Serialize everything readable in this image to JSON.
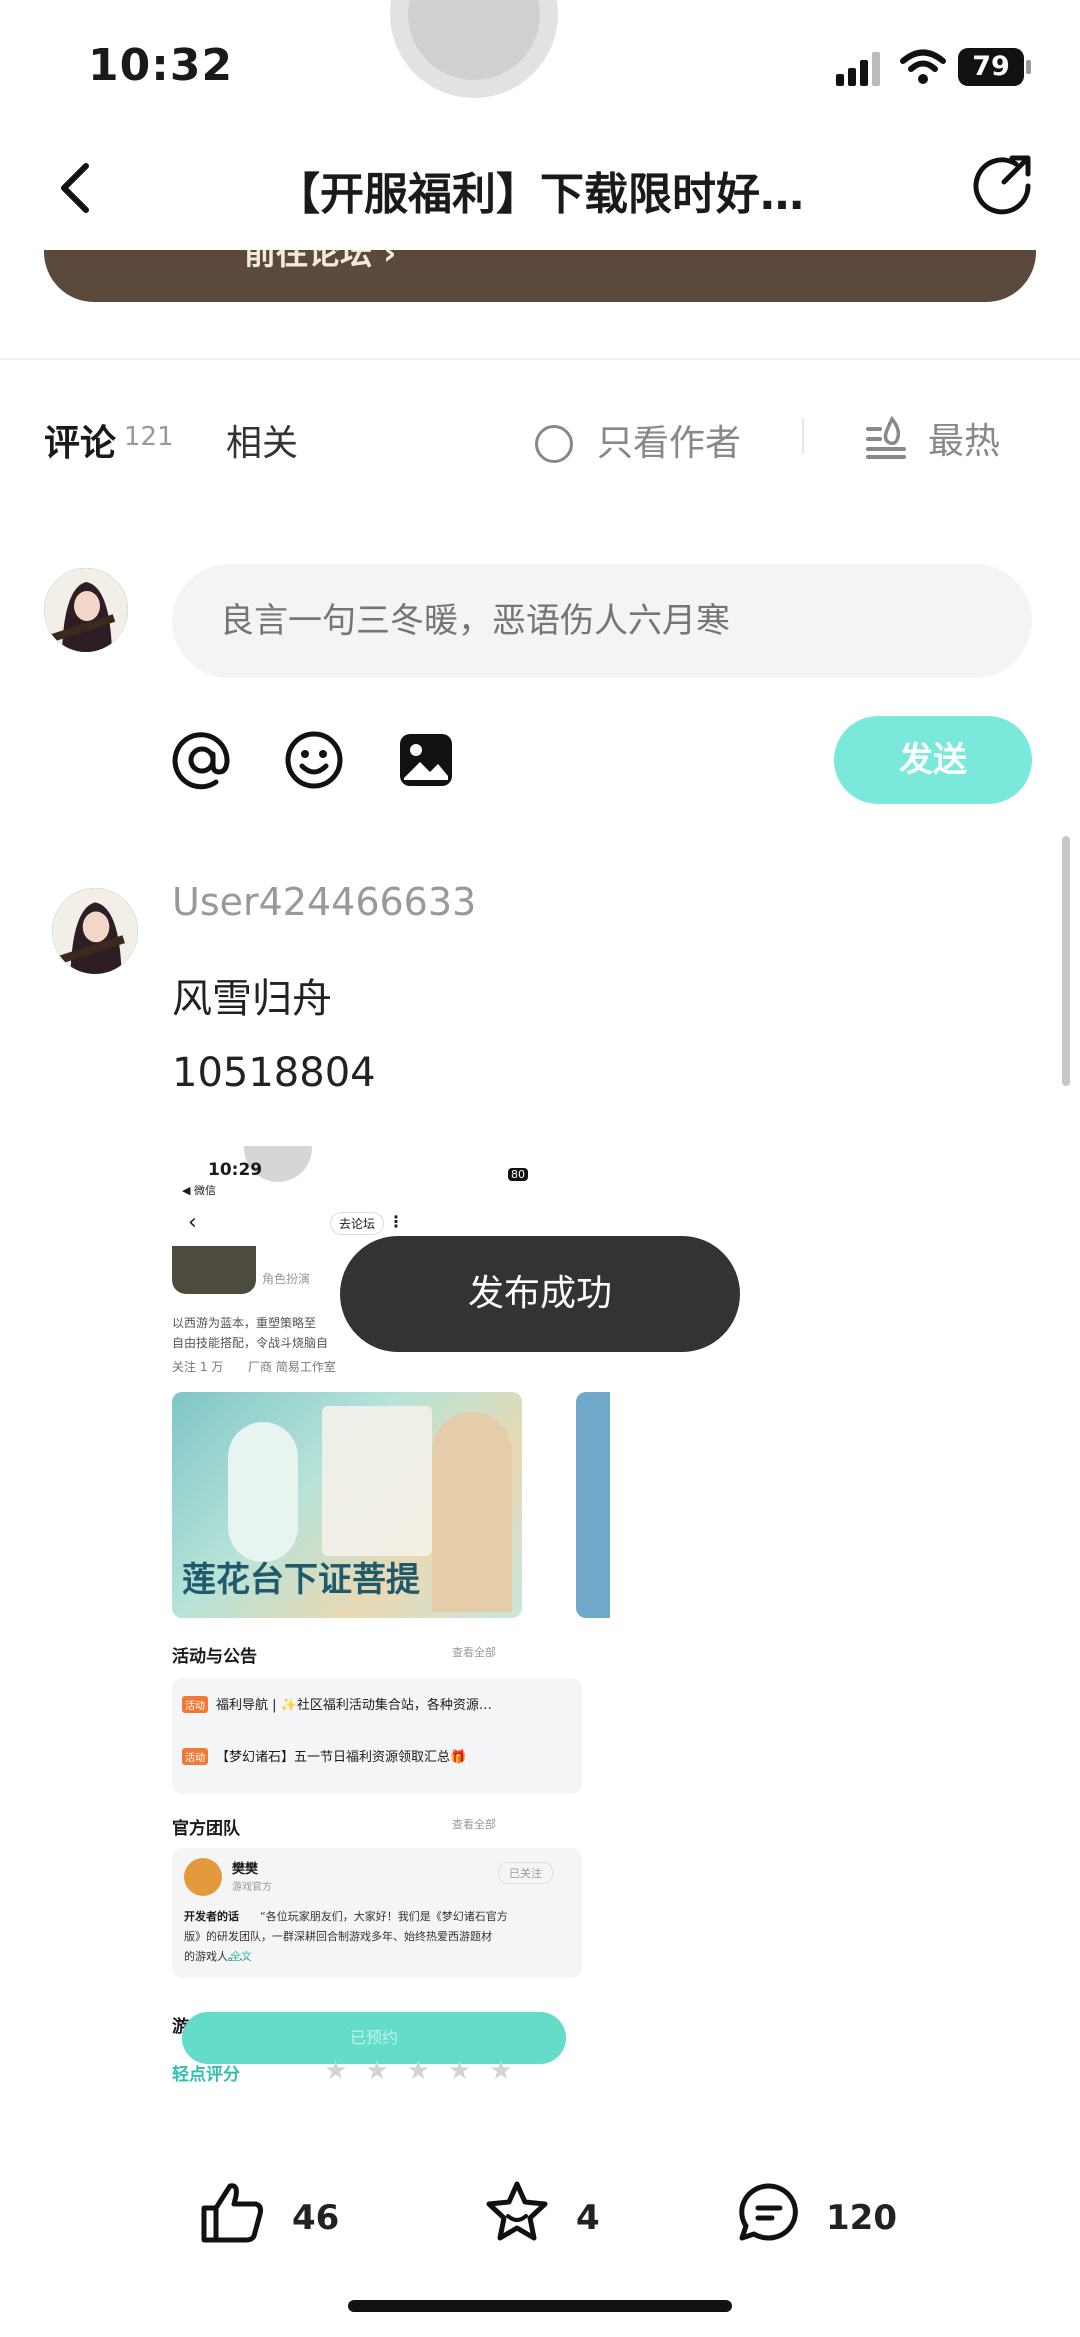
{
  "status_bar": {
    "time": "10:32",
    "battery": "79"
  },
  "nav": {
    "title": "【开服福利】下载限时好…"
  },
  "banner": {
    "text": "前往论坛 ›"
  },
  "tabs": {
    "comments_label": "评论",
    "comments_count": "121",
    "related_label": "相关",
    "only_author_label": "只看作者",
    "sort_label": "最热"
  },
  "composer": {
    "placeholder": "良言一句三冬暖，恶语伤人六月寒",
    "send_label": "发送"
  },
  "comment": {
    "username": "User424466633",
    "line1": "风雪归舟",
    "line2": "10518804"
  },
  "toast": {
    "text": "发布成功"
  },
  "screenshot": {
    "time": "10:29",
    "wechat": "◀ 微信",
    "battery": "80",
    "forum_button": "去论坛",
    "role": "角色扮演",
    "desc1": "以西游为蓝本，重塑策略至",
    "desc2": "自由技能搭配，令战斗烧脑自",
    "followers": "关注 1 万",
    "studio": "厂商 简易工作室",
    "game_text": "莲花台下证菩提",
    "activity_title": "活动与公告",
    "view_all": "查看全部",
    "tag": "活动",
    "announce1": "福利导航 | ✨社区福利活动集合站，各种资源…",
    "announce2": "【梦幻诸石】五一节日福利资源领取汇总🎁",
    "team_title": "官方团队",
    "team_view_all": "查看全部",
    "dev_name": "樊樊",
    "dev_role": "游戏官方",
    "followed": "已关注",
    "dev_words_label": "开发者的话",
    "dev_words1": "“各位玩家朋友们，大家好！我们是《梦幻诸石官方",
    "dev_words2": "版》的研发团队，一群深耕回合制游戏多年、始终热爱西游题材",
    "dev_words3": "的游戏人。…",
    "full_text": "全文",
    "reserved": "已预约",
    "rating_label": "轻点评分",
    "rating_cut": "游"
  },
  "stats": {
    "likes": "46",
    "favorites": "4",
    "comments": "120"
  }
}
